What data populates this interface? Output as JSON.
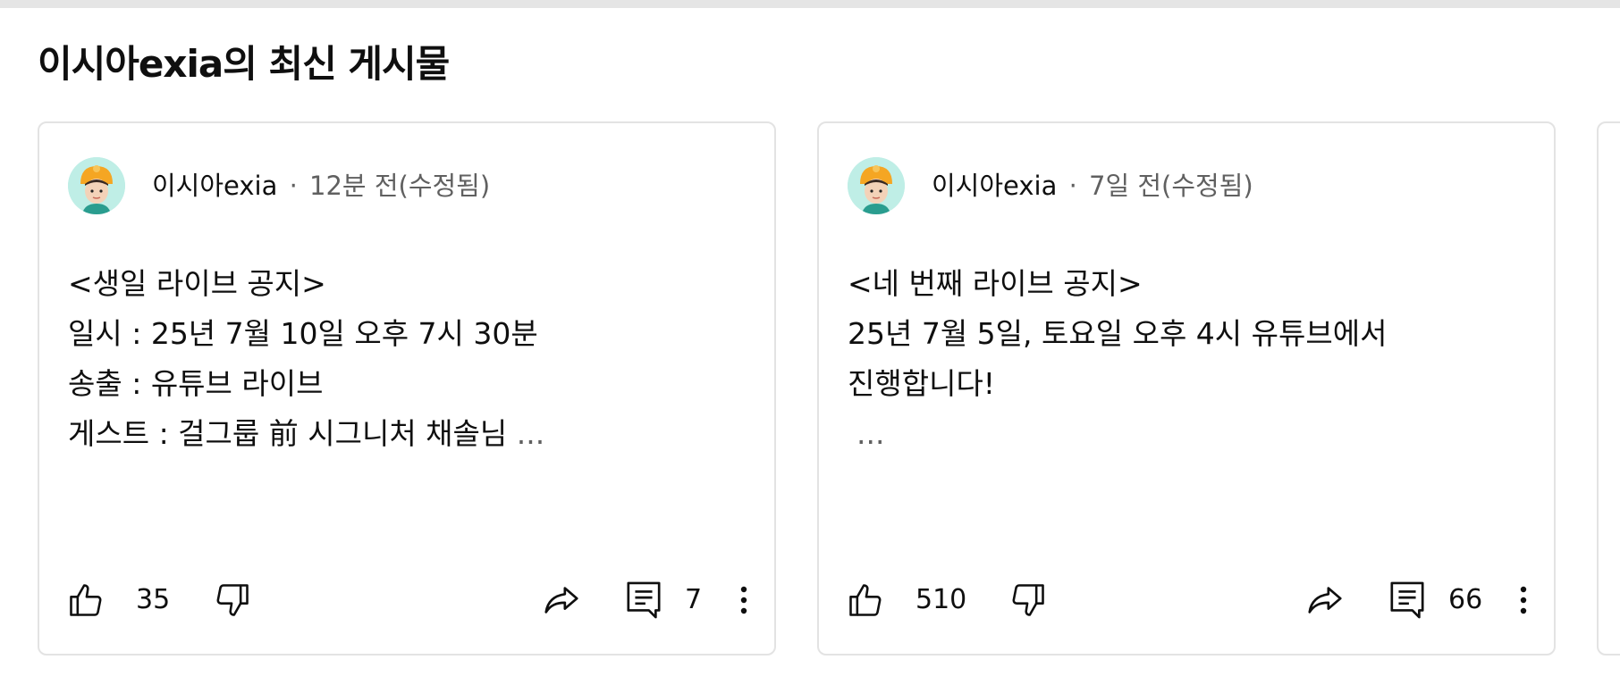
{
  "section": {
    "title": "이시아exia의 최신 게시물"
  },
  "posts": [
    {
      "author": "이시아exia",
      "separator": "·",
      "time": "12분 전(수정됨)",
      "lines": [
        "<생일 라이브 공지>",
        "일시 : 25년 7월 10일 오후 7시 30분",
        "송출 : 유튜브 라이브",
        "게스트 : 걸그룹 前 시그니처 채솔님"
      ],
      "more": "...",
      "likes": "35",
      "comments": "7"
    },
    {
      "author": "이시아exia",
      "separator": "·",
      "time": "7일 전(수정됨)",
      "lines": [
        "<네 번째 라이브 공지>",
        "25년 7월 5일, 토요일 오후 4시 유튜브에서",
        "진행합니다!"
      ],
      "more": "...",
      "likes": "510",
      "comments": "66"
    }
  ],
  "icons": {
    "like": "thumbs-up-icon",
    "dislike": "thumbs-down-icon",
    "share": "share-icon",
    "comment": "comment-icon",
    "more": "more-vert-icon"
  },
  "colors": {
    "text": "#0f0f0f",
    "secondary": "#606060",
    "border": "#e3e3e3",
    "avatar_bg": "#bfeee6",
    "avatar_hat": "#f5a623"
  }
}
